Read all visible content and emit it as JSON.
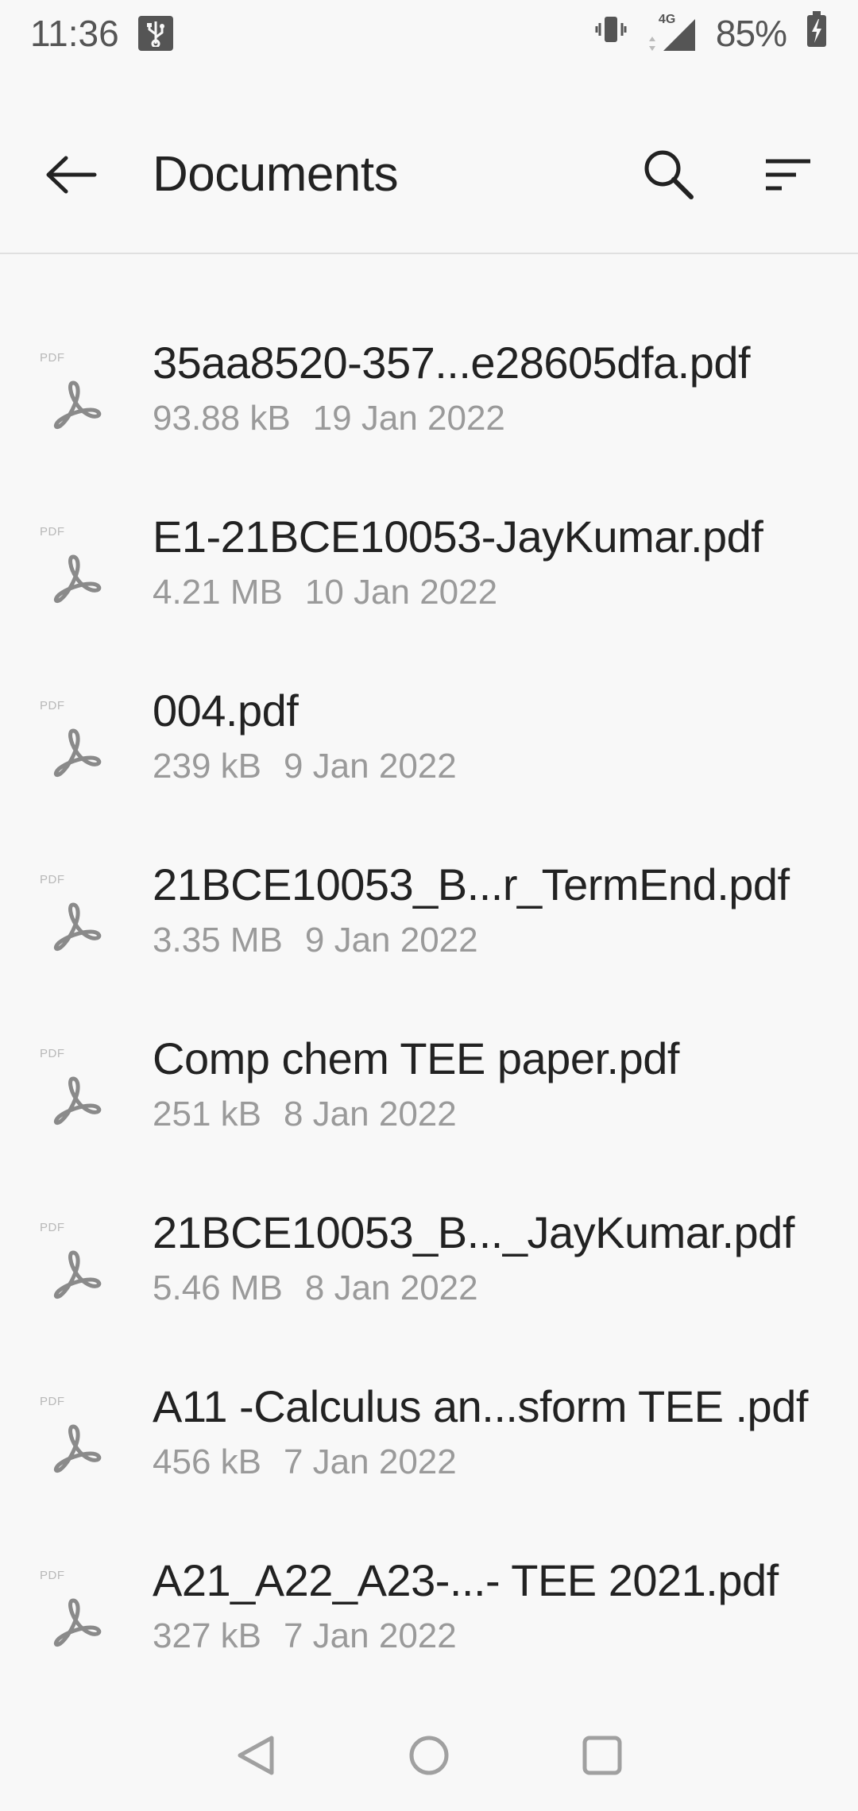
{
  "status_bar": {
    "time": "11:36",
    "network": "4G",
    "battery_percent": "85%"
  },
  "app_bar": {
    "title": "Documents"
  },
  "icons": {
    "back": "arrow-left-icon",
    "search": "search-icon",
    "sort": "sort-icon",
    "file": "pdf-file-icon"
  },
  "file_icon_label": "PDF",
  "files": [
    {
      "name": "35aa8520-357...e28605dfa.pdf",
      "size": "93.88 kB",
      "date": "19 Jan 2022"
    },
    {
      "name": "E1-21BCE10053-JayKumar.pdf",
      "size": "4.21 MB",
      "date": "10 Jan 2022"
    },
    {
      "name": "004.pdf",
      "size": "239 kB",
      "date": "9 Jan 2022"
    },
    {
      "name": "21BCE10053_B...r_TermEnd.pdf",
      "size": "3.35 MB",
      "date": "9 Jan 2022"
    },
    {
      "name": "Comp chem TEE paper.pdf",
      "size": "251 kB",
      "date": "8 Jan 2022"
    },
    {
      "name": "21BCE10053_B..._JayKumar.pdf",
      "size": "5.46 MB",
      "date": "8 Jan 2022"
    },
    {
      "name": "A11 -Calculus an...sform TEE .pdf",
      "size": "456 kB",
      "date": "7 Jan 2022"
    },
    {
      "name": "A21_A22_A23-...- TEE 2021.pdf",
      "size": "327 kB",
      "date": "7 Jan 2022"
    }
  ],
  "colors": {
    "background": "#f8f8f8",
    "text_primary": "#222222",
    "text_secondary": "#9a9a9a",
    "icon_gray": "#8a8a8a"
  }
}
